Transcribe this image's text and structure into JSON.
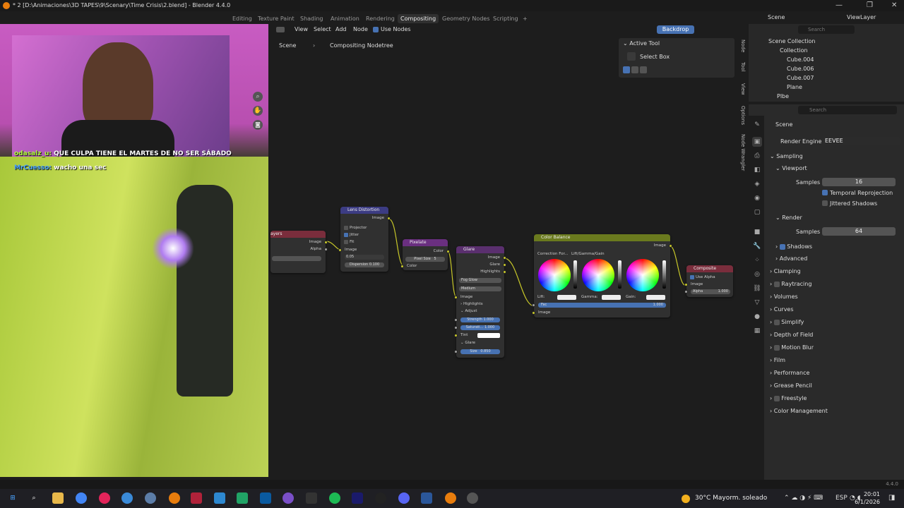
{
  "titlebar": {
    "title": "* 2 [D:\\Animaciones\\3D TAPES\\9\\Scenary\\Time Crisis\\2.blend] - Blender 4.4.0",
    "minimize": "—",
    "maximize": "❐",
    "close": "✕"
  },
  "workspaces": [
    "Editing",
    "Texture Paint",
    "Shading",
    "Animation",
    "Rendering",
    "Compositing",
    "Geometry Nodes",
    "Scripting",
    "+"
  ],
  "header": {
    "menus": [
      "View",
      "Select",
      "Add",
      "Node"
    ],
    "use_nodes_label": "Use Nodes",
    "backdrop_label": "Backdrop",
    "scene_label": "Scene",
    "viewlayer_label": "ViewLayer"
  },
  "breadcrumb": {
    "scene": "Scene",
    "tree": "Compositing Nodetree"
  },
  "tool_panel": {
    "title": "Active Tool",
    "tool": "Select Box"
  },
  "side_tabs": [
    "Node",
    "Tool",
    "View",
    "Options",
    "Node Wrangler"
  ],
  "nodes": {
    "layers": {
      "title": "ayers",
      "image": "Image",
      "alpha": "Alpha"
    },
    "lens": {
      "title": "Lens Distortion",
      "image_out": "Image",
      "projector": "Projector",
      "jitter": "Jitter",
      "fit": "Fit",
      "image_in": "Image",
      "distortion": "0.05",
      "dispersion": "Dispersion",
      "dispersion_val": "0.100"
    },
    "pixelate": {
      "title": "Pixelate",
      "color_out": "Color",
      "pixel_size": "Pixel Size",
      "pixel_size_val": "5",
      "color_in": "Color"
    },
    "glare": {
      "title": "Glare",
      "image_out": "Image",
      "glare_out": "Glare",
      "highlights_out": "Highlights",
      "type": "Fog Glow",
      "quality": "Medium",
      "image_in": "Image",
      "highlights": "Highlights",
      "adjust": "Adjust",
      "strength": "Strength",
      "strength_val": "1.000",
      "saturation": "Saturati...",
      "saturation_val": "1.000",
      "tint": "Tint",
      "glare_sec": "Glare",
      "size": "Size",
      "size_val": "0.850"
    },
    "color_balance": {
      "title": "Color Balance",
      "image_out": "Image",
      "correction": "Correction For...",
      "mode": "Lift/Gamma/Gain",
      "lift": "Lift:",
      "gamma": "Gamma:",
      "gain": "Gain:",
      "fac": "Fac",
      "fac_val": "1.000",
      "image_in": "Image"
    },
    "composite": {
      "title": "Composite",
      "use_alpha": "Use Alpha",
      "image": "Image",
      "alpha": "Alpha",
      "alpha_val": "1.000"
    }
  },
  "outliner": {
    "search_placeholder": "Search",
    "items": [
      "Scene Collection",
      "Collection",
      "Cube.004",
      "Cube.006",
      "Cube.007",
      "Plane",
      "Plbe"
    ]
  },
  "properties": {
    "search_placeholder": "Search",
    "scene": "Scene",
    "render_engine_label": "Render Engine",
    "render_engine": "EEVEE",
    "sampling": "Sampling",
    "viewport": "Viewport",
    "samples_label": "Samples",
    "viewport_samples": "16",
    "temporal": "Temporal Reprojection",
    "jittered": "Jittered Shadows",
    "render": "Render",
    "render_samples": "64",
    "shadows": "Shadows",
    "advanced": "Advanced",
    "sections": [
      "Clamping",
      "Raytracing",
      "Volumes",
      "Curves",
      "Simplify",
      "Depth of Field",
      "Motion Blur",
      "Film",
      "Performance",
      "Grease Pencil",
      "Freestyle",
      "Color Management"
    ]
  },
  "chat": [
    {
      "user": "odasalz_u:",
      "msg": "QUE CULPA TIENE EL MARTES DE NO SER SÁBADO",
      "color": "#b0ff3a"
    },
    {
      "user": "MrCuesso:",
      "msg": "wacho una sec",
      "color": "#4aa3ff"
    }
  ],
  "status": {
    "version": "4.4.0"
  },
  "taskbar": {
    "weather": "30°C  Mayorm. soleado",
    "lang": "ESP",
    "time": "20:01",
    "date": "6/1/2026"
  }
}
